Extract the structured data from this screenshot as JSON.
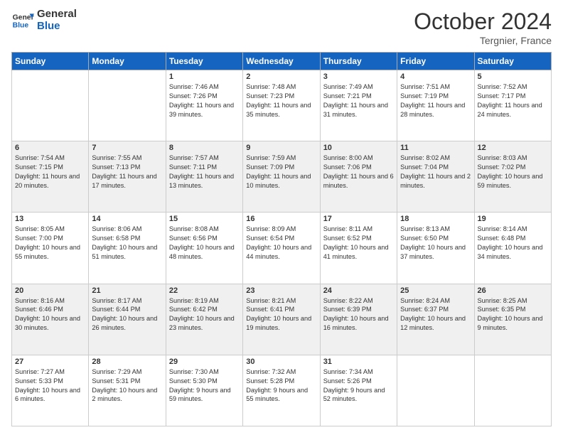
{
  "logo": {
    "line1": "General",
    "line2": "Blue"
  },
  "title": "October 2024",
  "location": "Tergnier, France",
  "days_of_week": [
    "Sunday",
    "Monday",
    "Tuesday",
    "Wednesday",
    "Thursday",
    "Friday",
    "Saturday"
  ],
  "weeks": [
    [
      {
        "day": "",
        "content": ""
      },
      {
        "day": "",
        "content": ""
      },
      {
        "day": "1",
        "content": "Sunrise: 7:46 AM\nSunset: 7:26 PM\nDaylight: 11 hours and 39 minutes."
      },
      {
        "day": "2",
        "content": "Sunrise: 7:48 AM\nSunset: 7:23 PM\nDaylight: 11 hours and 35 minutes."
      },
      {
        "day": "3",
        "content": "Sunrise: 7:49 AM\nSunset: 7:21 PM\nDaylight: 11 hours and 31 minutes."
      },
      {
        "day": "4",
        "content": "Sunrise: 7:51 AM\nSunset: 7:19 PM\nDaylight: 11 hours and 28 minutes."
      },
      {
        "day": "5",
        "content": "Sunrise: 7:52 AM\nSunset: 7:17 PM\nDaylight: 11 hours and 24 minutes."
      }
    ],
    [
      {
        "day": "6",
        "content": "Sunrise: 7:54 AM\nSunset: 7:15 PM\nDaylight: 11 hours and 20 minutes."
      },
      {
        "day": "7",
        "content": "Sunrise: 7:55 AM\nSunset: 7:13 PM\nDaylight: 11 hours and 17 minutes."
      },
      {
        "day": "8",
        "content": "Sunrise: 7:57 AM\nSunset: 7:11 PM\nDaylight: 11 hours and 13 minutes."
      },
      {
        "day": "9",
        "content": "Sunrise: 7:59 AM\nSunset: 7:09 PM\nDaylight: 11 hours and 10 minutes."
      },
      {
        "day": "10",
        "content": "Sunrise: 8:00 AM\nSunset: 7:06 PM\nDaylight: 11 hours and 6 minutes."
      },
      {
        "day": "11",
        "content": "Sunrise: 8:02 AM\nSunset: 7:04 PM\nDaylight: 11 hours and 2 minutes."
      },
      {
        "day": "12",
        "content": "Sunrise: 8:03 AM\nSunset: 7:02 PM\nDaylight: 10 hours and 59 minutes."
      }
    ],
    [
      {
        "day": "13",
        "content": "Sunrise: 8:05 AM\nSunset: 7:00 PM\nDaylight: 10 hours and 55 minutes."
      },
      {
        "day": "14",
        "content": "Sunrise: 8:06 AM\nSunset: 6:58 PM\nDaylight: 10 hours and 51 minutes."
      },
      {
        "day": "15",
        "content": "Sunrise: 8:08 AM\nSunset: 6:56 PM\nDaylight: 10 hours and 48 minutes."
      },
      {
        "day": "16",
        "content": "Sunrise: 8:09 AM\nSunset: 6:54 PM\nDaylight: 10 hours and 44 minutes."
      },
      {
        "day": "17",
        "content": "Sunrise: 8:11 AM\nSunset: 6:52 PM\nDaylight: 10 hours and 41 minutes."
      },
      {
        "day": "18",
        "content": "Sunrise: 8:13 AM\nSunset: 6:50 PM\nDaylight: 10 hours and 37 minutes."
      },
      {
        "day": "19",
        "content": "Sunrise: 8:14 AM\nSunset: 6:48 PM\nDaylight: 10 hours and 34 minutes."
      }
    ],
    [
      {
        "day": "20",
        "content": "Sunrise: 8:16 AM\nSunset: 6:46 PM\nDaylight: 10 hours and 30 minutes."
      },
      {
        "day": "21",
        "content": "Sunrise: 8:17 AM\nSunset: 6:44 PM\nDaylight: 10 hours and 26 minutes."
      },
      {
        "day": "22",
        "content": "Sunrise: 8:19 AM\nSunset: 6:42 PM\nDaylight: 10 hours and 23 minutes."
      },
      {
        "day": "23",
        "content": "Sunrise: 8:21 AM\nSunset: 6:41 PM\nDaylight: 10 hours and 19 minutes."
      },
      {
        "day": "24",
        "content": "Sunrise: 8:22 AM\nSunset: 6:39 PM\nDaylight: 10 hours and 16 minutes."
      },
      {
        "day": "25",
        "content": "Sunrise: 8:24 AM\nSunset: 6:37 PM\nDaylight: 10 hours and 12 minutes."
      },
      {
        "day": "26",
        "content": "Sunrise: 8:25 AM\nSunset: 6:35 PM\nDaylight: 10 hours and 9 minutes."
      }
    ],
    [
      {
        "day": "27",
        "content": "Sunrise: 7:27 AM\nSunset: 5:33 PM\nDaylight: 10 hours and 6 minutes."
      },
      {
        "day": "28",
        "content": "Sunrise: 7:29 AM\nSunset: 5:31 PM\nDaylight: 10 hours and 2 minutes."
      },
      {
        "day": "29",
        "content": "Sunrise: 7:30 AM\nSunset: 5:30 PM\nDaylight: 9 hours and 59 minutes."
      },
      {
        "day": "30",
        "content": "Sunrise: 7:32 AM\nSunset: 5:28 PM\nDaylight: 9 hours and 55 minutes."
      },
      {
        "day": "31",
        "content": "Sunrise: 7:34 AM\nSunset: 5:26 PM\nDaylight: 9 hours and 52 minutes."
      },
      {
        "day": "",
        "content": ""
      },
      {
        "day": "",
        "content": ""
      }
    ]
  ]
}
